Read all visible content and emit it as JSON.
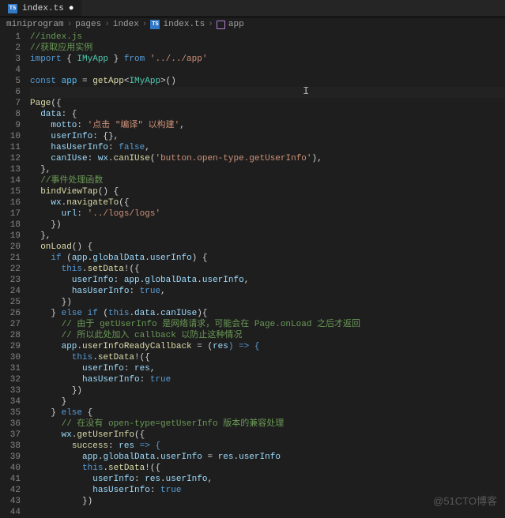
{
  "tab": {
    "label": "index.ts",
    "icon_text": "TS"
  },
  "breadcrumb": {
    "seg1": "miniprogram",
    "seg2": "pages",
    "seg3": "index",
    "seg4_icon": "TS",
    "seg4": "index.ts",
    "seg5": "app"
  },
  "watermark": "@51CTO博客",
  "chart_data": {
    "type": "table",
    "title": "TypeScript source: index.ts",
    "columns": [
      "line_number",
      "code"
    ],
    "rows": [
      [
        1,
        "//index.js"
      ],
      [
        2,
        "//获取应用实例"
      ],
      [
        3,
        "import { IMyApp } from '../../app'"
      ],
      [
        4,
        ""
      ],
      [
        5,
        "const app = getApp<IMyApp>()"
      ],
      [
        6,
        ""
      ],
      [
        7,
        "Page({"
      ],
      [
        8,
        "  data: {"
      ],
      [
        9,
        "    motto: '点击 \"编译\" 以构建',"
      ],
      [
        10,
        "    userInfo: {},"
      ],
      [
        11,
        "    hasUserInfo: false,"
      ],
      [
        12,
        "    canIUse: wx.canIUse('button.open-type.getUserInfo'),"
      ],
      [
        13,
        "  },"
      ],
      [
        14,
        "  //事件处理函数"
      ],
      [
        15,
        "  bindViewTap() {"
      ],
      [
        16,
        "    wx.navigateTo({"
      ],
      [
        17,
        "      url: '../logs/logs'"
      ],
      [
        18,
        "    })"
      ],
      [
        19,
        "  },"
      ],
      [
        20,
        "  onLoad() {"
      ],
      [
        21,
        "    if (app.globalData.userInfo) {"
      ],
      [
        22,
        "      this.setData!({"
      ],
      [
        23,
        "        userInfo: app.globalData.userInfo,"
      ],
      [
        24,
        "        hasUserInfo: true,"
      ],
      [
        25,
        "      })"
      ],
      [
        26,
        "    } else if (this.data.canIUse){"
      ],
      [
        27,
        "      // 由于 getUserInfo 是网络请求，可能会在 Page.onLoad 之后才返回"
      ],
      [
        28,
        "      // 所以此处加入 callback 以防止这种情况"
      ],
      [
        29,
        "      app.userInfoReadyCallback = (res) => {"
      ],
      [
        30,
        "        this.setData!({"
      ],
      [
        31,
        "          userInfo: res,"
      ],
      [
        32,
        "          hasUserInfo: true"
      ],
      [
        33,
        "        })"
      ],
      [
        34,
        "      }"
      ],
      [
        35,
        "    } else {"
      ],
      [
        36,
        "      // 在没有 open-type=getUserInfo 版本的兼容处理"
      ],
      [
        37,
        "      wx.getUserInfo({"
      ],
      [
        38,
        "        success: res => {"
      ],
      [
        39,
        "          app.globalData.userInfo = res.userInfo"
      ],
      [
        40,
        "          this.setData!({"
      ],
      [
        41,
        "            userInfo: res.userInfo,"
      ],
      [
        42,
        "            hasUserInfo: true"
      ],
      [
        43,
        "          })"
      ],
      [
        44,
        ""
      ]
    ]
  },
  "lines": {
    "l1": "//index.js",
    "l2": "//获取应用实例",
    "l3_import": "import",
    "l3_brace_o": "{ ",
    "l3_type": "IMyApp",
    "l3_brace_c": " }",
    "l3_from": " from ",
    "l3_path": "'../../app'",
    "l5_const": "const",
    "l5_app": " app",
    "l5_eq": " = ",
    "l5_fn": "getApp",
    "l5_lt": "<",
    "l5_type": "IMyApp",
    "l5_gt": ">",
    "l5_paren": "()",
    "l7_page": "Page",
    "l7_open": "({",
    "l8_data": "data",
    "l8_colon": ": {",
    "l9_motto": "motto",
    "l9_c": ": ",
    "l9_str": "'点击 \"编译\" 以构建'",
    "l9_comma": ",",
    "l10_ui": "userInfo",
    "l10_v": ": {},",
    "l11_hui": "hasUserInfo",
    "l11_c": ": ",
    "l11_false": "false",
    "l11_comma": ",",
    "l12_ciu": "canIUse",
    "l12_c": ": ",
    "l12_wx": "wx",
    "l12_dot": ".",
    "l12_fn": "canIUse",
    "l12_po": "(",
    "l12_str": "'button.open-type.getUserInfo'",
    "l12_pc": "),",
    "l13": "},",
    "l14": "//事件处理函数",
    "l15_fn": "bindViewTap",
    "l15_p": "() {",
    "l16_wx": "wx",
    "l16_dot": ".",
    "l16_fn": "navigateTo",
    "l16_open": "({",
    "l17_url": "url",
    "l17_c": ": ",
    "l17_str": "'../logs/logs'",
    "l18": "})",
    "l19": "},",
    "l20_fn": "onLoad",
    "l20_p": "() {",
    "l21_if": "if",
    "l21_po": " (",
    "l21_app": "app",
    "l21_d1": ".",
    "l21_gd": "globalData",
    "l21_d2": ".",
    "l21_ui": "userInfo",
    "l21_pc": ") {",
    "l22_this": "this",
    "l22_d": ".",
    "l22_fn": "setData",
    "l22_bang": "!({",
    "l23_ui": "userInfo",
    "l23_c": ": ",
    "l23_app": "app",
    "l23_d1": ".",
    "l23_gd": "globalData",
    "l23_d2": ".",
    "l23_ui2": "userInfo",
    "l23_comma": ",",
    "l24_hui": "hasUserInfo",
    "l24_c": ": ",
    "l24_true": "true",
    "l24_comma": ",",
    "l25": "})",
    "l26_cb": "} ",
    "l26_else": "else if",
    "l26_po": " (",
    "l26_this": "this",
    "l26_d1": ".",
    "l26_data": "data",
    "l26_d2": ".",
    "l26_ciu": "canIUse",
    "l26_pc": "){",
    "l27": "// 由于 getUserInfo 是网络请求，可能会在 Page.onLoad 之后才返回",
    "l28": "// 所以此处加入 callback 以防止这种情况",
    "l29_app": "app",
    "l29_d": ".",
    "l29_cb": "userInfoReadyCallback",
    "l29_eq": " = (",
    "l29_res": "res",
    "l29_arrow": ") => {",
    "l30_this": "this",
    "l30_d": ".",
    "l30_fn": "setData",
    "l30_bang": "!({",
    "l31_ui": "userInfo",
    "l31_c": ": ",
    "l31_res": "res",
    "l31_comma": ",",
    "l32_hui": "hasUserInfo",
    "l32_c": ": ",
    "l32_true": "true",
    "l33": "})",
    "l34": "}",
    "l35_cb": "} ",
    "l35_else": "else",
    "l35_ob": " {",
    "l36": "// 在没有 open-type=getUserInfo 版本的兼容处理",
    "l37_wx": "wx",
    "l37_d": ".",
    "l37_fn": "getUserInfo",
    "l37_open": "({",
    "l38_suc": "success",
    "l38_c": ": ",
    "l38_res": "res",
    "l38_arrow": " => {",
    "l39_app": "app",
    "l39_d1": ".",
    "l39_gd": "globalData",
    "l39_d2": ".",
    "l39_ui": "userInfo",
    "l39_eq": " = ",
    "l39_res": "res",
    "l39_d3": ".",
    "l39_ui2": "userInfo",
    "l40_this": "this",
    "l40_d": ".",
    "l40_fn": "setData",
    "l40_bang": "!({",
    "l41_ui": "userInfo",
    "l41_c": ": ",
    "l41_res": "res",
    "l41_d": ".",
    "l41_ui2": "userInfo",
    "l41_comma": ",",
    "l42_hui": "hasUserInfo",
    "l42_c": ": ",
    "l42_true": "true",
    "l43": "})"
  }
}
